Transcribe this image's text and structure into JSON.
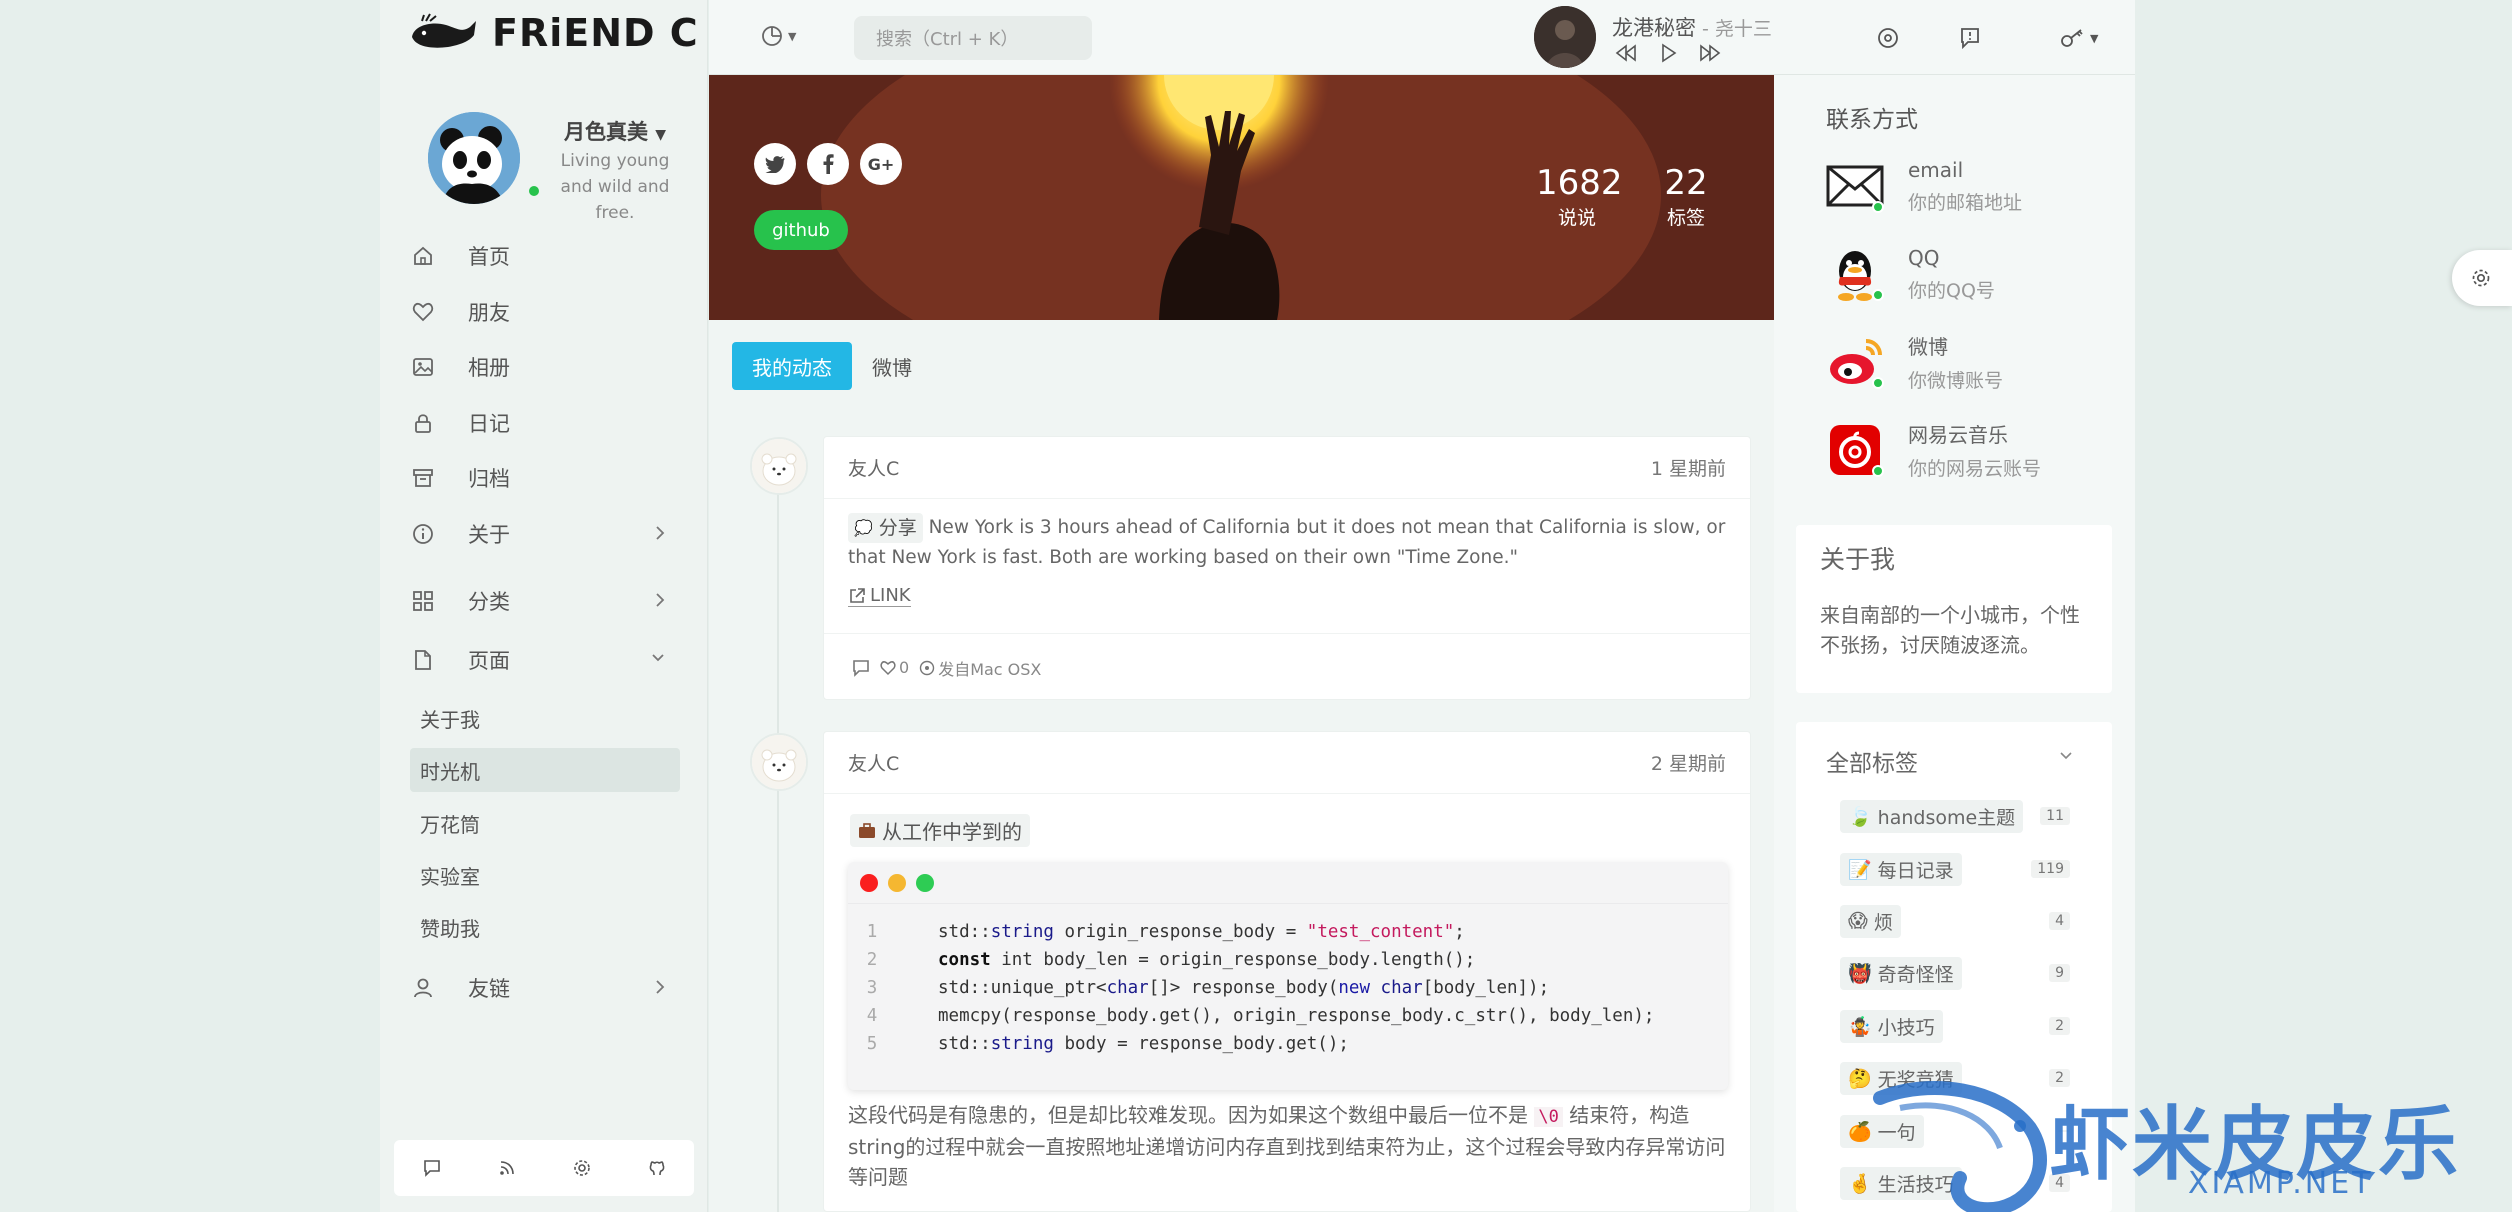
{
  "brand": {
    "name": "FRiEND C"
  },
  "profile": {
    "name": "月色真美",
    "motto": "Living young and wild and free."
  },
  "nav": {
    "items": [
      {
        "label": "首页",
        "icon": "home-icon"
      },
      {
        "label": "朋友",
        "icon": "heart-icon"
      },
      {
        "label": "相册",
        "icon": "image-icon"
      },
      {
        "label": "日记",
        "icon": "lock-icon"
      },
      {
        "label": "归档",
        "icon": "archive-icon"
      },
      {
        "label": "关于",
        "icon": "info-icon"
      },
      {
        "label": "分类",
        "icon": "grid-icon"
      },
      {
        "label": "页面",
        "icon": "file-icon"
      }
    ],
    "subpages": [
      "关于我",
      "时光机",
      "万花筒",
      "实验室",
      "赞助我"
    ],
    "links": {
      "label": "友链",
      "icon": "user-icon"
    }
  },
  "header": {
    "search_placeholder": "搜索（Ctrl + K）",
    "music": {
      "title": "龙港秘密",
      "artist": " - 尧十三"
    }
  },
  "cover": {
    "github_label": "github",
    "stats": [
      {
        "value": "1682",
        "label": "说说"
      },
      {
        "value": "22",
        "label": "标签"
      }
    ]
  },
  "tabs": {
    "active": "我的动态",
    "other": "微博"
  },
  "posts": [
    {
      "author": "友人C",
      "time": "1 星期前",
      "chip": "分享",
      "text": "New York is 3 hours ahead of California but it does not mean that California is slow, or that New York is fast. Both are working based on their own \"Time Zone.\"",
      "link_label": "LINK",
      "likes": "0",
      "source": "发自Mac OSX"
    },
    {
      "author": "友人C",
      "time": "2 星期前",
      "chip": "从工作中学到的",
      "code": [
        "std::string origin_response_body = \"test_content\";",
        "const int body_len = origin_response_body.length();",
        "std::unique_ptr<char[]> response_body(new char[body_len]);",
        "memcpy(response_body.get(), origin_response_body.c_str(), body_len);",
        "std::string body = response_body.get();"
      ],
      "code_line_numbers": [
        "1",
        "2",
        "3",
        "4",
        "5"
      ],
      "text_before": "这段代码是有隐患的，但是却比较难发现。因为如果这个数组中最后一位不是",
      "inline_code": "\\0",
      "text_after": "结束符，构造string的过程中就会一直按照地址递增访问内存直到找到结束符为止，这个过程会导致内存异常访问等问题"
    }
  ],
  "contacts": {
    "title": "联系方式",
    "items": [
      {
        "name": "email",
        "value": "你的邮箱地址",
        "icon": "mail-icon"
      },
      {
        "name": "QQ",
        "value": "你的QQ号",
        "icon": "qq-icon"
      },
      {
        "name": "微博",
        "value": "你微博账号",
        "icon": "weibo-icon"
      },
      {
        "name": "网易云音乐",
        "value": "你的网易云账号",
        "icon": "netease-music-icon"
      }
    ]
  },
  "about": {
    "title": "关于我",
    "text": "来自南部的一个小城市，个性不张扬，讨厌随波逐流。"
  },
  "tags": {
    "title": "全部标签",
    "items": [
      {
        "name": "handsome主题",
        "count": "11"
      },
      {
        "name": "每日记录",
        "count": "119"
      },
      {
        "name": "烦",
        "count": "4"
      },
      {
        "name": "奇奇怪怪",
        "count": "9"
      },
      {
        "name": "小技巧",
        "count": "2"
      },
      {
        "name": "无奖竞猜",
        "count": "2"
      },
      {
        "name": "一句",
        "count": ""
      },
      {
        "name": "生活技巧",
        "count": "4"
      }
    ]
  },
  "watermark": {
    "cn": "虾米皮皮乐",
    "en": "XIAMP.NET"
  },
  "colors": {
    "accent": "#23b7e5",
    "online": "#27c24c",
    "background": "#e6efec"
  }
}
